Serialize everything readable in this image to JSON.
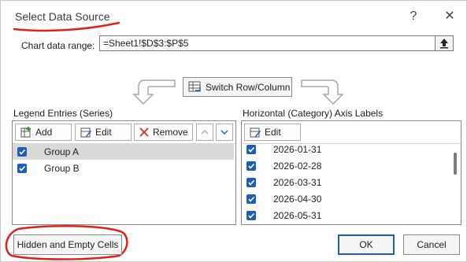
{
  "window": {
    "title": "Select Data Source",
    "help_label": "?",
    "close_label": "✕"
  },
  "chart_range": {
    "label": "Chart data range:",
    "value": "=Sheet1!$D$3:$P$5"
  },
  "switch_button": {
    "label": "Switch Row/Column"
  },
  "legend": {
    "heading": "Legend Entries (Series)",
    "add_label": "Add",
    "edit_label": "Edit",
    "remove_label": "Remove",
    "items": [
      {
        "label": "Group A",
        "checked": true,
        "selected": true
      },
      {
        "label": "Group B",
        "checked": true,
        "selected": false
      }
    ]
  },
  "axis": {
    "heading": "Horizontal (Category) Axis Labels",
    "edit_label": "Edit",
    "items": [
      {
        "label": "2026-01-31",
        "checked": true
      },
      {
        "label": "2026-02-28",
        "checked": true
      },
      {
        "label": "2026-03-31",
        "checked": true
      },
      {
        "label": "2026-04-30",
        "checked": true
      },
      {
        "label": "2026-05-31",
        "checked": true
      }
    ]
  },
  "footer": {
    "hidden_cells_label": "Hidden and Empty Cells",
    "ok_label": "OK",
    "cancel_label": "Cancel"
  },
  "colors": {
    "accent": "#1f5fb3",
    "annotation": "#e0201a",
    "selected_row": "#d9d9d9"
  }
}
